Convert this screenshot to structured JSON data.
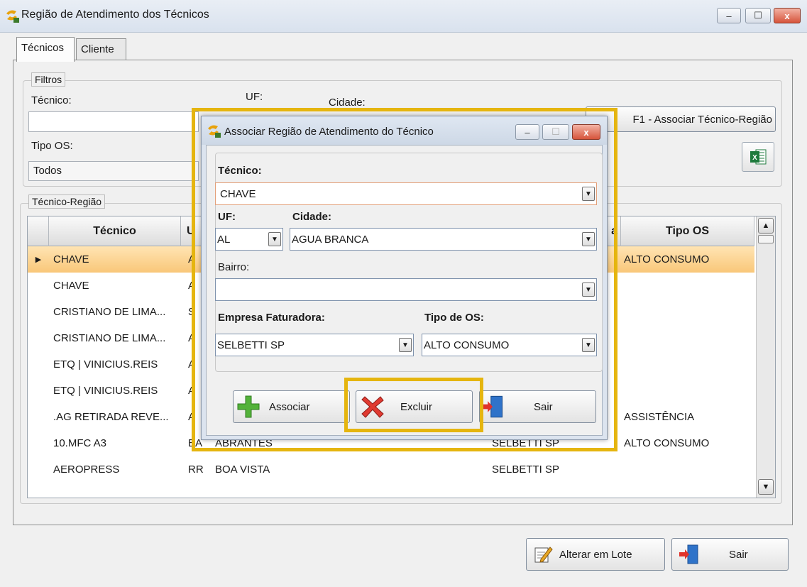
{
  "window": {
    "title": "Região de Atendimento dos Técnicos",
    "controls": {
      "minimize": "–",
      "maximize": "☐",
      "close": "x"
    }
  },
  "tabs": [
    {
      "label": "Técnicos",
      "active": true
    },
    {
      "label": "Cliente",
      "active": false
    }
  ],
  "filtros": {
    "legend": "Filtros",
    "tecnico_label": "Técnico:",
    "tecnico_value": "",
    "uf_label": "UF:",
    "cidade_label": "Cidade:",
    "tipo_os_label": "Tipo OS:",
    "tipo_os_value": "Todos",
    "associar_button": "F1 - Associar Técnico-Região",
    "excel_icon_text": "X"
  },
  "grid": {
    "legend": "Técnico-Região",
    "columns": [
      "Técnico",
      "U",
      "a",
      "Tipo OS"
    ],
    "rows": [
      {
        "tecnico": "CHAVE",
        "uf": "A",
        "cidade": "",
        "empresa": "",
        "tipo_os": "ALTO CONSUMO",
        "selected": true
      },
      {
        "tecnico": "CHAVE",
        "uf": "A",
        "cidade": "",
        "empresa": "",
        "tipo_os": "",
        "selected": false
      },
      {
        "tecnico": "CRISTIANO DE LIMA...",
        "uf": "S",
        "cidade": "",
        "empresa": "",
        "tipo_os": "",
        "selected": false
      },
      {
        "tecnico": "CRISTIANO DE LIMA...",
        "uf": "A",
        "cidade": "",
        "empresa": "",
        "tipo_os": "",
        "selected": false
      },
      {
        "tecnico": "ETQ | VINICIUS.REIS",
        "uf": "A",
        "cidade": "",
        "empresa": "",
        "tipo_os": "",
        "selected": false
      },
      {
        "tecnico": "ETQ | VINICIUS.REIS",
        "uf": "A",
        "cidade": "",
        "empresa": "",
        "tipo_os": "",
        "selected": false
      },
      {
        "tecnico": ".AG RETIRADA REVE...",
        "uf": "A",
        "cidade": "",
        "empresa": "",
        "tipo_os": "ASSISTÊNCIA",
        "selected": false
      },
      {
        "tecnico": "10.MFC A3",
        "uf": "BA",
        "cidade": "ABRANTES",
        "empresa": "SELBETTI SP",
        "tipo_os": "ALTO CONSUMO",
        "selected": false
      },
      {
        "tecnico": "AEROPRESS",
        "uf": "RR",
        "cidade": "BOA VISTA",
        "empresa": "SELBETTI SP",
        "tipo_os": "",
        "selected": false
      }
    ]
  },
  "bottom_buttons": {
    "alterar": "Alterar em Lote",
    "sair": "Sair"
  },
  "dialog": {
    "title": "Associar Região de Atendimento do Técnico",
    "tecnico_label": "Técnico:",
    "tecnico_value": "CHAVE",
    "uf_label": "UF:",
    "uf_value": "AL",
    "cidade_label": "Cidade:",
    "cidade_value": "AGUA BRANCA",
    "bairro_label": "Bairro:",
    "bairro_value": "",
    "empresa_label": "Empresa Faturadora:",
    "empresa_value": "SELBETTI SP",
    "tipo_os_label": "Tipo de OS:",
    "tipo_os_value": "ALTO CONSUMO",
    "associar_button": "Associar",
    "excluir_button": "Excluir",
    "sair_button": "Sair"
  },
  "colors": {
    "highlight": "#e5b50f",
    "selected_row": "#f9c779"
  }
}
